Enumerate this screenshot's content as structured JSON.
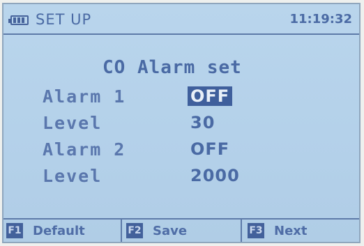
{
  "header": {
    "battery_icon": "battery-icon",
    "title": "SET UP",
    "time": "11:19:32"
  },
  "main": {
    "heading": "CO Alarm set",
    "rows": [
      {
        "label": "Alarm 1",
        "value": "OFF",
        "selected": true
      },
      {
        "label": "Level",
        "value": "30",
        "selected": false
      },
      {
        "label": "Alarm 2",
        "value": "OFF",
        "selected": false
      },
      {
        "label": "Level",
        "value": "2000",
        "selected": false
      }
    ]
  },
  "footer": {
    "keys": [
      {
        "key": "F1",
        "label": "Default"
      },
      {
        "key": "F2",
        "label": "Save"
      },
      {
        "key": "F3",
        "label": "Next"
      }
    ]
  },
  "colors": {
    "screen_bg": "#b6d3eb",
    "text": "#4a6aa4",
    "highlight": "#3f5f9c"
  }
}
